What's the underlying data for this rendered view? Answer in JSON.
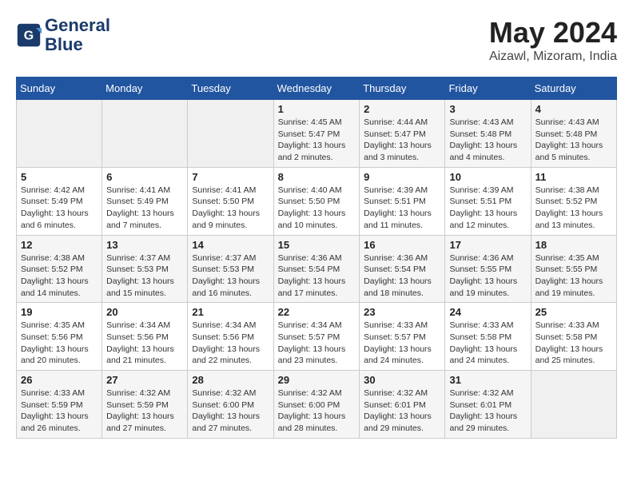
{
  "header": {
    "logo_line1": "General",
    "logo_line2": "Blue",
    "month": "May 2024",
    "location": "Aizawl, Mizoram, India"
  },
  "weekdays": [
    "Sunday",
    "Monday",
    "Tuesday",
    "Wednesday",
    "Thursday",
    "Friday",
    "Saturday"
  ],
  "weeks": [
    [
      {
        "day": "",
        "info": ""
      },
      {
        "day": "",
        "info": ""
      },
      {
        "day": "",
        "info": ""
      },
      {
        "day": "1",
        "info": "Sunrise: 4:45 AM\nSunset: 5:47 PM\nDaylight: 13 hours\nand 2 minutes."
      },
      {
        "day": "2",
        "info": "Sunrise: 4:44 AM\nSunset: 5:47 PM\nDaylight: 13 hours\nand 3 minutes."
      },
      {
        "day": "3",
        "info": "Sunrise: 4:43 AM\nSunset: 5:48 PM\nDaylight: 13 hours\nand 4 minutes."
      },
      {
        "day": "4",
        "info": "Sunrise: 4:43 AM\nSunset: 5:48 PM\nDaylight: 13 hours\nand 5 minutes."
      }
    ],
    [
      {
        "day": "5",
        "info": "Sunrise: 4:42 AM\nSunset: 5:49 PM\nDaylight: 13 hours\nand 6 minutes."
      },
      {
        "day": "6",
        "info": "Sunrise: 4:41 AM\nSunset: 5:49 PM\nDaylight: 13 hours\nand 7 minutes."
      },
      {
        "day": "7",
        "info": "Sunrise: 4:41 AM\nSunset: 5:50 PM\nDaylight: 13 hours\nand 9 minutes."
      },
      {
        "day": "8",
        "info": "Sunrise: 4:40 AM\nSunset: 5:50 PM\nDaylight: 13 hours\nand 10 minutes."
      },
      {
        "day": "9",
        "info": "Sunrise: 4:39 AM\nSunset: 5:51 PM\nDaylight: 13 hours\nand 11 minutes."
      },
      {
        "day": "10",
        "info": "Sunrise: 4:39 AM\nSunset: 5:51 PM\nDaylight: 13 hours\nand 12 minutes."
      },
      {
        "day": "11",
        "info": "Sunrise: 4:38 AM\nSunset: 5:52 PM\nDaylight: 13 hours\nand 13 minutes."
      }
    ],
    [
      {
        "day": "12",
        "info": "Sunrise: 4:38 AM\nSunset: 5:52 PM\nDaylight: 13 hours\nand 14 minutes."
      },
      {
        "day": "13",
        "info": "Sunrise: 4:37 AM\nSunset: 5:53 PM\nDaylight: 13 hours\nand 15 minutes."
      },
      {
        "day": "14",
        "info": "Sunrise: 4:37 AM\nSunset: 5:53 PM\nDaylight: 13 hours\nand 16 minutes."
      },
      {
        "day": "15",
        "info": "Sunrise: 4:36 AM\nSunset: 5:54 PM\nDaylight: 13 hours\nand 17 minutes."
      },
      {
        "day": "16",
        "info": "Sunrise: 4:36 AM\nSunset: 5:54 PM\nDaylight: 13 hours\nand 18 minutes."
      },
      {
        "day": "17",
        "info": "Sunrise: 4:36 AM\nSunset: 5:55 PM\nDaylight: 13 hours\nand 19 minutes."
      },
      {
        "day": "18",
        "info": "Sunrise: 4:35 AM\nSunset: 5:55 PM\nDaylight: 13 hours\nand 19 minutes."
      }
    ],
    [
      {
        "day": "19",
        "info": "Sunrise: 4:35 AM\nSunset: 5:56 PM\nDaylight: 13 hours\nand 20 minutes."
      },
      {
        "day": "20",
        "info": "Sunrise: 4:34 AM\nSunset: 5:56 PM\nDaylight: 13 hours\nand 21 minutes."
      },
      {
        "day": "21",
        "info": "Sunrise: 4:34 AM\nSunset: 5:56 PM\nDaylight: 13 hours\nand 22 minutes."
      },
      {
        "day": "22",
        "info": "Sunrise: 4:34 AM\nSunset: 5:57 PM\nDaylight: 13 hours\nand 23 minutes."
      },
      {
        "day": "23",
        "info": "Sunrise: 4:33 AM\nSunset: 5:57 PM\nDaylight: 13 hours\nand 24 minutes."
      },
      {
        "day": "24",
        "info": "Sunrise: 4:33 AM\nSunset: 5:58 PM\nDaylight: 13 hours\nand 24 minutes."
      },
      {
        "day": "25",
        "info": "Sunrise: 4:33 AM\nSunset: 5:58 PM\nDaylight: 13 hours\nand 25 minutes."
      }
    ],
    [
      {
        "day": "26",
        "info": "Sunrise: 4:33 AM\nSunset: 5:59 PM\nDaylight: 13 hours\nand 26 minutes."
      },
      {
        "day": "27",
        "info": "Sunrise: 4:32 AM\nSunset: 5:59 PM\nDaylight: 13 hours\nand 27 minutes."
      },
      {
        "day": "28",
        "info": "Sunrise: 4:32 AM\nSunset: 6:00 PM\nDaylight: 13 hours\nand 27 minutes."
      },
      {
        "day": "29",
        "info": "Sunrise: 4:32 AM\nSunset: 6:00 PM\nDaylight: 13 hours\nand 28 minutes."
      },
      {
        "day": "30",
        "info": "Sunrise: 4:32 AM\nSunset: 6:01 PM\nDaylight: 13 hours\nand 29 minutes."
      },
      {
        "day": "31",
        "info": "Sunrise: 4:32 AM\nSunset: 6:01 PM\nDaylight: 13 hours\nand 29 minutes."
      },
      {
        "day": "",
        "info": ""
      }
    ]
  ]
}
